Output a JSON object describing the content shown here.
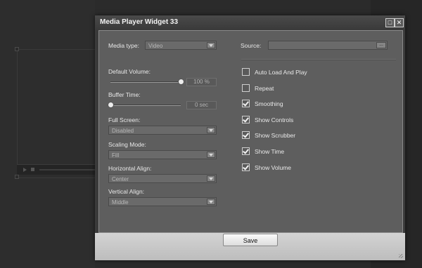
{
  "window": {
    "title": "Media Player Widget 33",
    "restore_glyph": "□",
    "close_glyph": "✕"
  },
  "media_type": {
    "label": "Media type:",
    "value": "Video"
  },
  "source": {
    "label": "Source:",
    "value": "",
    "browse_label": "..."
  },
  "default_volume": {
    "label": "Default Volume:",
    "value": 100,
    "readout": "100 %"
  },
  "buffer_time": {
    "label": "Buffer Time:",
    "value": 0,
    "readout": "0 sec"
  },
  "full_screen": {
    "label": "Full Screen:",
    "value": "Disabled"
  },
  "scaling_mode": {
    "label": "Scaling Mode:",
    "value": "Fill"
  },
  "horizontal_align": {
    "label": "Horizontal Align:",
    "value": "Center"
  },
  "vertical_align": {
    "label": "Vertical Align:",
    "value": "Middle"
  },
  "options": [
    {
      "label": "Auto Load And Play",
      "checked": false
    },
    {
      "label": "Repeat",
      "checked": false
    },
    {
      "label": "Smoothing",
      "checked": true
    },
    {
      "label": "Show Controls",
      "checked": true
    },
    {
      "label": "Show Scrubber",
      "checked": true
    },
    {
      "label": "Show Time",
      "checked": true
    },
    {
      "label": "Show Volume",
      "checked": true
    }
  ],
  "footer": {
    "save_label": "Save"
  }
}
